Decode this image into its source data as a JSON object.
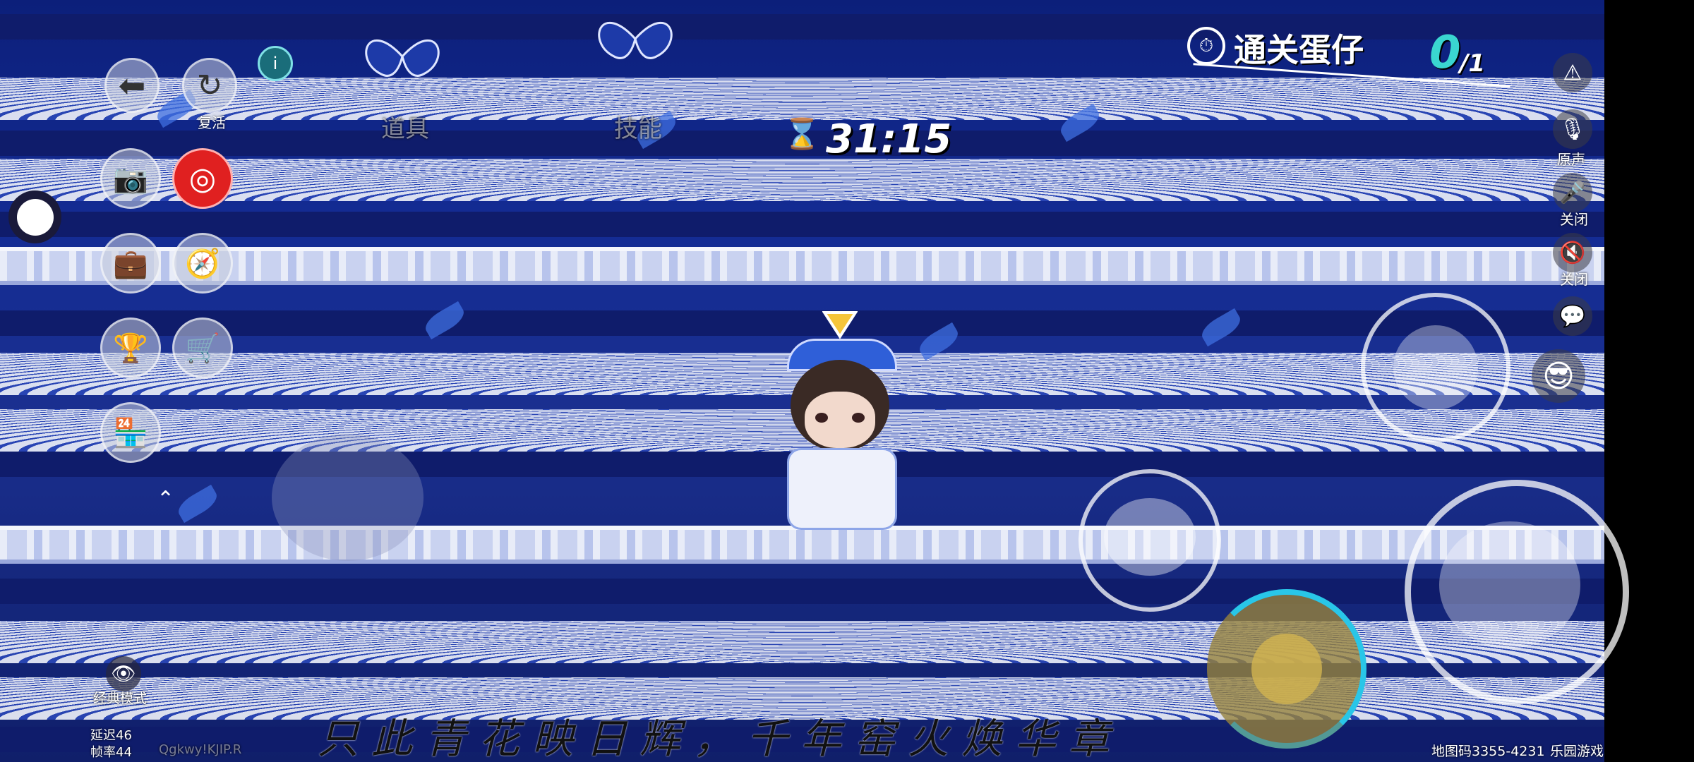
{
  "hud": {
    "mission_title": "通关蛋仔",
    "mission_progress_current": "0",
    "mission_progress_total": "/1",
    "timer": "31:15",
    "top_label_1": "道具",
    "top_label_2": "技能",
    "back_label": "",
    "refresh_label": "复活",
    "classic_mode_label": "经典模式",
    "latency": "延迟46",
    "fps": "帧率44",
    "room_code": "Qgkwy!KJIP.R",
    "map_code": "地图码3355-4231",
    "map_suffix": "乐园游戏",
    "caption": "只此青花映日辉，千年窑火焕华章"
  },
  "right_panel": {
    "warning_icon": "warning-icon",
    "voice_label": "原声",
    "mic_label": "关闭",
    "speaker_label": "关闭"
  },
  "colors": {
    "mission_progress": "#3ad6d0",
    "skill_ring": "#29c6e8",
    "music_button": "#e02020"
  }
}
